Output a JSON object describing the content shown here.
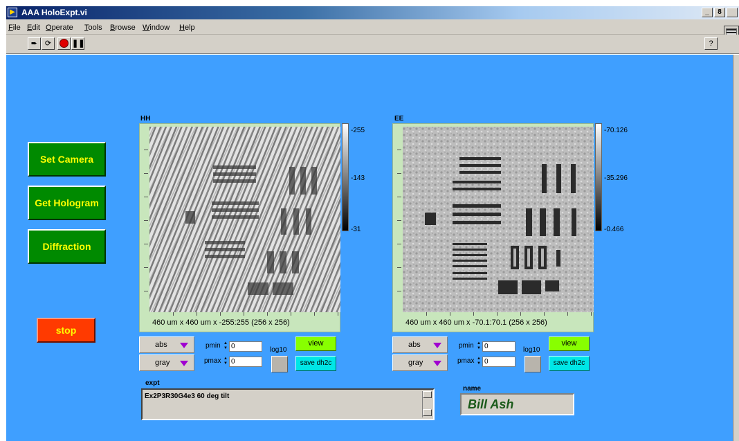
{
  "window": {
    "title": "AAA HoloExpt.vi",
    "buttons": [
      "_",
      "8",
      ""
    ]
  },
  "menu": [
    "File",
    "Edit",
    "Operate",
    "Tools",
    "Browse",
    "Window",
    "Help"
  ],
  "toolbar": {
    "run_icon": "run-arrow-icon",
    "run_continuous_icon": "run-continuous-icon",
    "abort_icon": "abort-stop-icon",
    "pause_icon": "pause-icon",
    "help_label": "?",
    "vi_icon_label": "1"
  },
  "buttons": {
    "set_camera": "Set Camera",
    "get_hologram": "Get Hologram",
    "diffraction": "Diffraction",
    "stop": "stop"
  },
  "graphs": [
    {
      "label": "HH",
      "caption": "460 um x 460 um x -255:255 (256 x 256)",
      "scale_max": "-255",
      "scale_mid": "-143",
      "scale_min": "-31",
      "mode": "abs",
      "colormap": "gray",
      "pmin_label": "pmin",
      "pmin_value": "0",
      "pmax_label": "pmax",
      "pmax_value": "0",
      "log_label": "log10",
      "view_label": "view",
      "save_label": "save dh2c"
    },
    {
      "label": "EE",
      "caption": "460 um x 460 um x -70.1:70.1 (256 x 256)",
      "scale_max": "-70.126",
      "scale_mid": "-35.296",
      "scale_min": "-0.466",
      "mode": "abs",
      "colormap": "gray",
      "pmin_label": "pmin",
      "pmin_value": "0",
      "pmax_label": "pmax",
      "pmax_value": "0",
      "log_label": "log10",
      "view_label": "view",
      "save_label": "save dh2c"
    }
  ],
  "expt": {
    "label": "expt",
    "value": "Ex2P3R30G4e3 60 deg tilt"
  },
  "name": {
    "label": "name",
    "value": "Bill Ash"
  },
  "colors": {
    "panel": "#3f9fff",
    "button_green": "#008a00",
    "button_text": "#ffff00",
    "stop_red": "#ff3a00",
    "graph_frame": "#c8e6bc",
    "view_green": "#88ff00",
    "save_cyan": "#00e6e6"
  }
}
